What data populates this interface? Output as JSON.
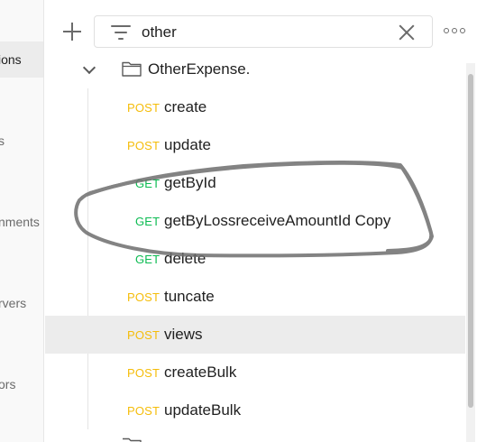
{
  "left_sidebar": {
    "items": [
      {
        "label": "ions",
        "active": true
      },
      {
        "label": "s",
        "active": false
      },
      {
        "label": "nments",
        "active": false
      },
      {
        "label": "rvers",
        "active": false
      },
      {
        "label": "ors",
        "active": false
      }
    ]
  },
  "toolbar": {
    "add_icon": "plus-icon",
    "filter_icon": "filter-icon",
    "search_value": "other",
    "clear_icon": "close-icon",
    "more_icon": "more-horizontal-icon"
  },
  "tree": {
    "folder": {
      "label": "OtherExpense.",
      "expanded": true
    },
    "requests": [
      {
        "method": "POST",
        "name": "create",
        "selected": false
      },
      {
        "method": "POST",
        "name": "update",
        "selected": false
      },
      {
        "method": "GET",
        "name": "getById",
        "selected": false
      },
      {
        "method": "GET",
        "name": "getByLossreceiveAmountId Copy",
        "selected": false
      },
      {
        "method": "GET",
        "name": "delete",
        "selected": false
      },
      {
        "method": "POST",
        "name": "tuncate",
        "selected": false
      },
      {
        "method": "POST",
        "name": "views",
        "selected": true
      },
      {
        "method": "POST",
        "name": "createBulk",
        "selected": false
      },
      {
        "method": "POST",
        "name": "updateBulk",
        "selected": false
      }
    ]
  },
  "colors": {
    "post": "#f5bd0a",
    "get": "#0cbb52",
    "selected_row": "#ececec",
    "annotation": "#6e6e6e"
  }
}
